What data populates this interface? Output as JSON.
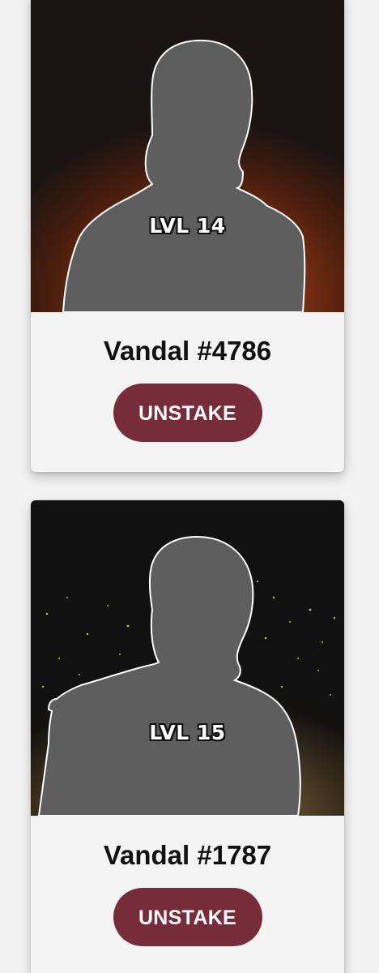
{
  "cards": [
    {
      "level_label": "LVL 14",
      "name": "Vandal #4786",
      "action_label": "UNSTAKE",
      "background_theme": "orange-glow",
      "accent_color": "#762c39"
    },
    {
      "level_label": "LVL 15",
      "name": "Vandal #1787",
      "action_label": "UNSTAKE",
      "background_theme": "gold-dust",
      "accent_color": "#762c39"
    }
  ]
}
